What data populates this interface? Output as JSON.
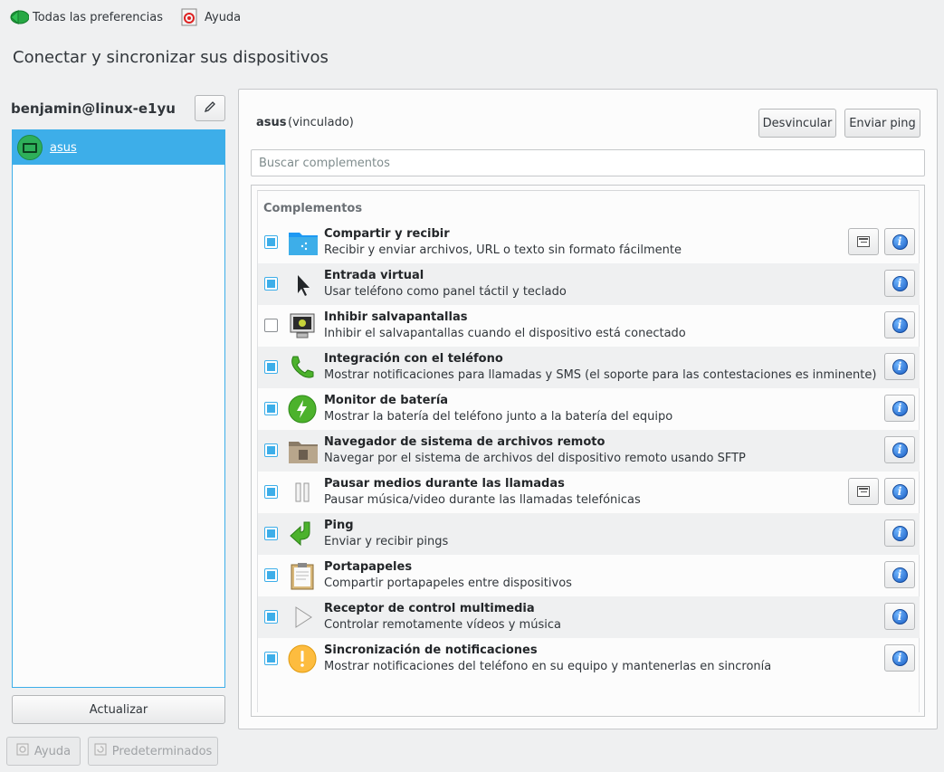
{
  "topbar": {
    "all_prefs": "Todas las preferencias",
    "help": "Ayuda"
  },
  "page_title": "Conectar y sincronizar sus dispositivos",
  "sidebar": {
    "user": "benjamin@linux-e1yu",
    "devices": [
      {
        "label": "asus"
      }
    ],
    "refresh": "Actualizar"
  },
  "footer": {
    "help": "Ayuda",
    "defaults": "Predeterminados"
  },
  "device": {
    "name": "asus",
    "status": "(vinculado)",
    "unpair": "Desvincular",
    "send_ping": "Enviar ping"
  },
  "search": {
    "placeholder": "Buscar complementos"
  },
  "plugins": {
    "section_title": "Complementos",
    "items": [
      {
        "title": "Compartir y recibir",
        "desc": "Recibir y enviar archivos, URL o texto sin formato fácilmente",
        "checked": true,
        "icon": "folder-share-icon",
        "configurable": true
      },
      {
        "title": "Entrada virtual",
        "desc": "Usar teléfono como panel táctil y teclado",
        "checked": true,
        "icon": "pointer-icon",
        "configurable": false
      },
      {
        "title": "Inhibir salvapantallas",
        "desc": "Inhibir el salvapantallas cuando el dispositivo está conectado",
        "checked": false,
        "icon": "monitor-icon",
        "configurable": false
      },
      {
        "title": "Integración con el teléfono",
        "desc": "Mostrar notificaciones para llamadas y SMS (el soporte para las contestaciones es inminente)",
        "checked": true,
        "icon": "phone-icon",
        "configurable": false
      },
      {
        "title": "Monitor de batería",
        "desc": "Mostrar la batería del teléfono junto a la batería del equipo",
        "checked": true,
        "icon": "battery-icon",
        "configurable": false
      },
      {
        "title": "Navegador de sistema de archivos remoto",
        "desc": "Navegar por el sistema de archivos del dispositivo remoto usando SFTP",
        "checked": true,
        "icon": "remote-folder-icon",
        "configurable": false
      },
      {
        "title": "Pausar medios durante las llamadas",
        "desc": "Pausar música/video durante las llamadas telefónicas",
        "checked": true,
        "icon": "pause-icon",
        "configurable": true
      },
      {
        "title": "Ping",
        "desc": "Enviar y recibir pings",
        "checked": true,
        "icon": "ping-arrow-icon",
        "configurable": false
      },
      {
        "title": "Portapapeles",
        "desc": "Compartir portapapeles entre dispositivos",
        "checked": true,
        "icon": "clipboard-icon",
        "configurable": false
      },
      {
        "title": "Receptor de control multimedia",
        "desc": "Controlar remotamente vídeos y música",
        "checked": true,
        "icon": "play-icon",
        "configurable": false
      },
      {
        "title": "Sincronización de notificaciones",
        "desc": "Mostrar notificaciones del teléfono en su equipo y mantenerlas en sincronía",
        "checked": true,
        "icon": "notification-icon",
        "configurable": false
      }
    ]
  },
  "colors": {
    "accent": "#3daee9",
    "background": "#eff0f1"
  }
}
